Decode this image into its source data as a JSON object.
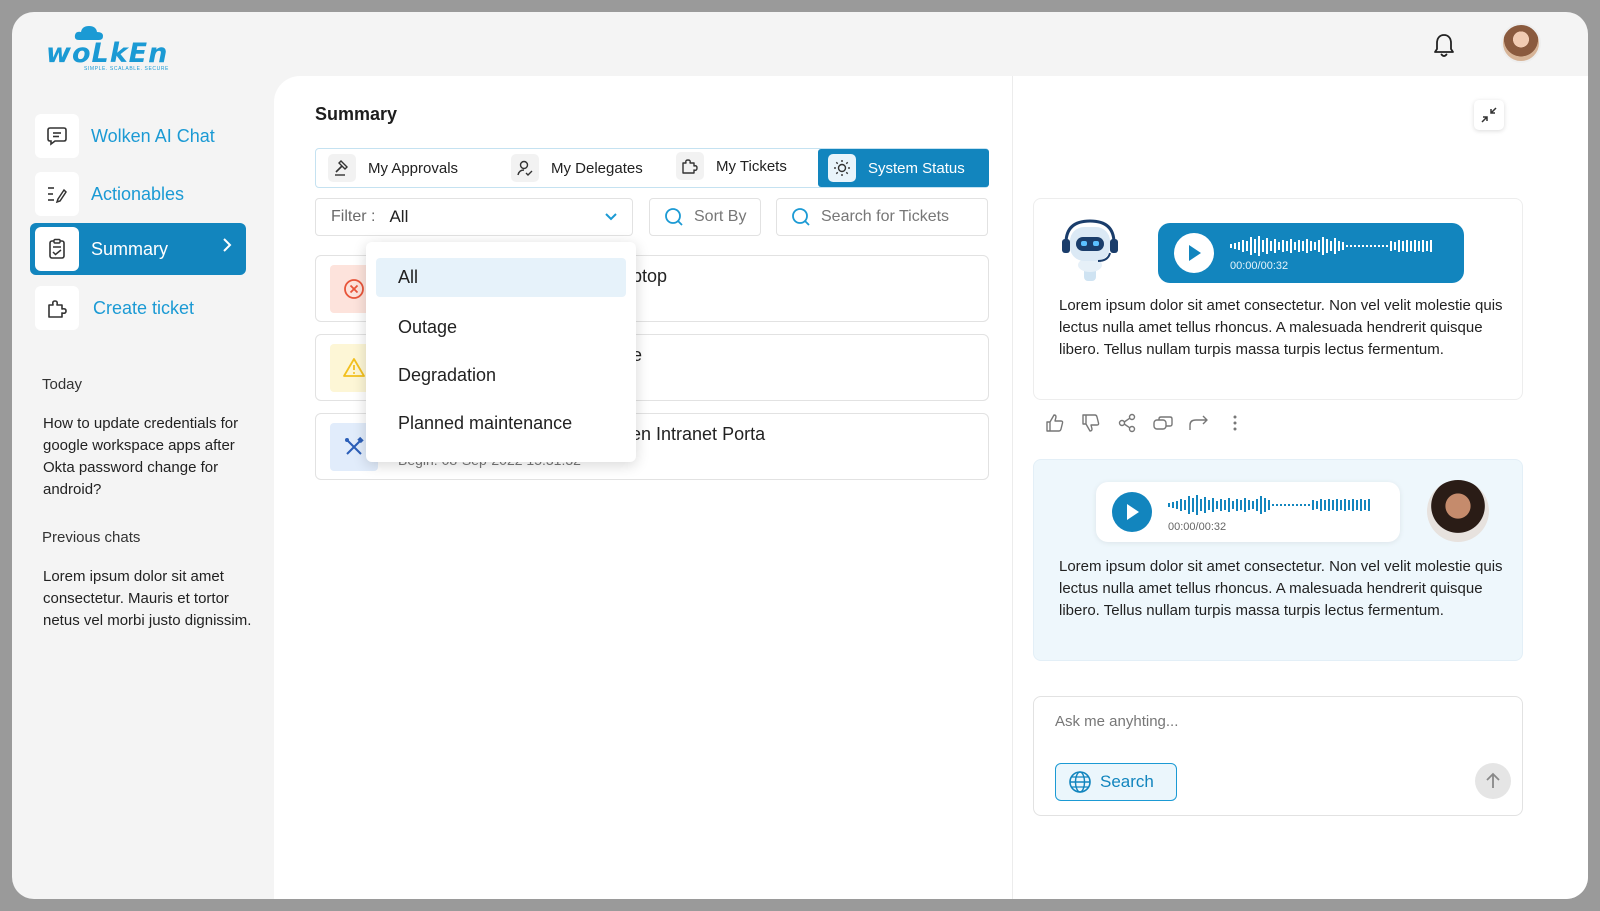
{
  "app": {
    "logo_text": "woLkEn",
    "logo_tagline": "SIMPLE. SCALABLE. SECURE"
  },
  "sidebar": {
    "items": [
      {
        "label": "Wolken AI Chat",
        "icon": "chat-icon"
      },
      {
        "label": "Actionables",
        "icon": "checklist-icon"
      },
      {
        "label": "Summary",
        "icon": "clipboard-icon",
        "active": true
      },
      {
        "label": "Create ticket",
        "icon": "puzzle-icon"
      }
    ],
    "today_heading": "Today",
    "today_chat": "How to update credentials for google workspace apps after Okta password change for android?",
    "previous_heading": "Previous chats",
    "previous_chat": "Lorem ipsum dolor sit amet consectetur. Mauris et tortor netus vel morbi justo dignissim."
  },
  "main": {
    "title": "Summary",
    "tabs": [
      {
        "label": "My Approvals",
        "icon": "hammer-icon"
      },
      {
        "label": "My Delegates",
        "icon": "user-check-icon"
      },
      {
        "label": "My Tickets",
        "icon": "puzzle-icon"
      },
      {
        "label": "System Status",
        "icon": "gear-sun-icon",
        "active": true
      }
    ],
    "filter": {
      "label": "Filter :",
      "value": "All"
    },
    "sort_label": "Sort By",
    "search_placeholder": "Search for Tickets",
    "dropdown_options": [
      "All",
      "Outage",
      "Degradation",
      "Planned maintenance"
    ],
    "tickets": [
      {
        "title_visible": "aptop",
        "sub_visible": "",
        "icon": "error-circle-icon",
        "color": "#fde3dc"
      },
      {
        "title_visible": "e",
        "sub_visible": "",
        "icon": "warning-icon",
        "color": "#fdf6d6"
      },
      {
        "title_visible": "ken Intranet Porta",
        "sub_visible": "Begin: 08-Sep-2022 15:31:32",
        "icon": "tools-icon",
        "color": "#e1ecfb"
      }
    ]
  },
  "chat": {
    "bot_message": "Lorem ipsum dolor sit amet consectetur. Non vel velit molestie quis lectus nulla amet tellus rhoncus. A malesuada hendrerit quisque libero. Tellus nullam turpis massa turpis lectus fermentum.",
    "bot_audio_time": "00:00/00:32",
    "user_message": "Lorem ipsum dolor sit amet consectetur. Non vel velit molestie quis lectus nulla amet tellus rhoncus. A malesuada hendrerit quisque libero. Tellus nullam turpis massa turpis lectus fermentum.",
    "user_audio_time": "00:00/00:32",
    "input_placeholder": "Ask me anyhting...",
    "search_button": "Search"
  },
  "colors": {
    "accent": "#1285be",
    "brand": "#1b9ad4"
  }
}
